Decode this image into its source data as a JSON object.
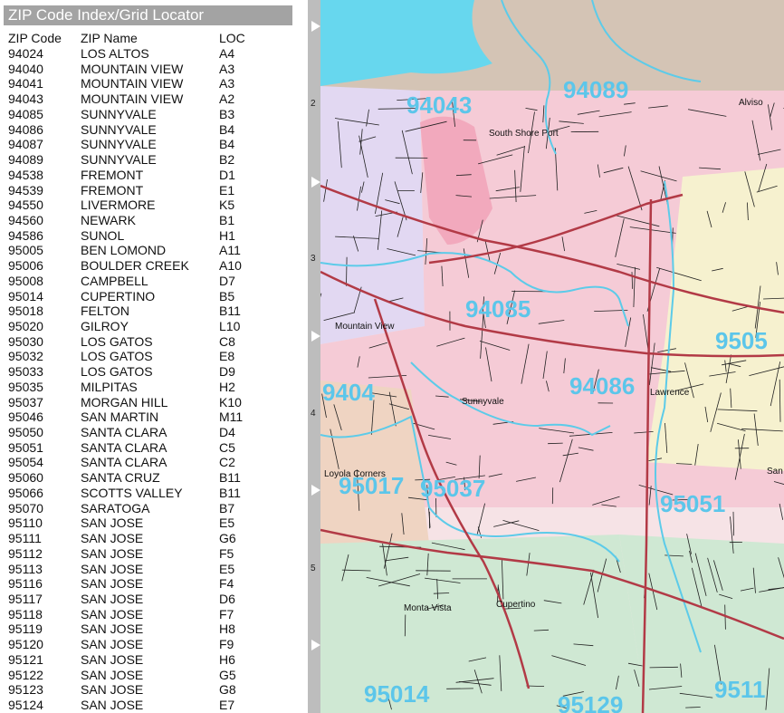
{
  "index": {
    "title": "ZIP Code Index/Grid Locator",
    "columns": [
      "ZIP Code",
      "ZIP Name",
      "LOC"
    ],
    "rows": [
      [
        "94024",
        "LOS ALTOS",
        "A4"
      ],
      [
        "94040",
        "MOUNTAIN VIEW",
        "A3"
      ],
      [
        "94041",
        "MOUNTAIN VIEW",
        "A3"
      ],
      [
        "94043",
        "MOUNTAIN VIEW",
        "A2"
      ],
      [
        "94085",
        "SUNNYVALE",
        "B3"
      ],
      [
        "94086",
        "SUNNYVALE",
        "B4"
      ],
      [
        "94087",
        "SUNNYVALE",
        "B4"
      ],
      [
        "94089",
        "SUNNYVALE",
        "B2"
      ],
      [
        "94538",
        "FREMONT",
        "D1"
      ],
      [
        "94539",
        "FREMONT",
        "E1"
      ],
      [
        "94550",
        "LIVERMORE",
        "K5"
      ],
      [
        "94560",
        "NEWARK",
        "B1"
      ],
      [
        "94586",
        "SUNOL",
        "H1"
      ],
      [
        "95005",
        "BEN LOMOND",
        "A11"
      ],
      [
        "95006",
        "BOULDER CREEK",
        "A10"
      ],
      [
        "95008",
        "CAMPBELL",
        "D7"
      ],
      [
        "95014",
        "CUPERTINO",
        "B5"
      ],
      [
        "95018",
        "FELTON",
        "B11"
      ],
      [
        "95020",
        "GILROY",
        "L10"
      ],
      [
        "95030",
        "LOS GATOS",
        "C8"
      ],
      [
        "95032",
        "LOS GATOS",
        "E8"
      ],
      [
        "95033",
        "LOS GATOS",
        "D9"
      ],
      [
        "95035",
        "MILPITAS",
        "H2"
      ],
      [
        "95037",
        "MORGAN HILL",
        "K10"
      ],
      [
        "95046",
        "SAN MARTIN",
        "M11"
      ],
      [
        "95050",
        "SANTA CLARA",
        "D4"
      ],
      [
        "95051",
        "SANTA CLARA",
        "C5"
      ],
      [
        "95054",
        "SANTA CLARA",
        "C2"
      ],
      [
        "95060",
        "SANTA CRUZ",
        "B11"
      ],
      [
        "95066",
        "SCOTTS VALLEY",
        "B11"
      ],
      [
        "95070",
        "SARATOGA",
        "B7"
      ],
      [
        "95110",
        "SAN JOSE",
        "E5"
      ],
      [
        "95111",
        "SAN JOSE",
        "G6"
      ],
      [
        "95112",
        "SAN JOSE",
        "F5"
      ],
      [
        "95113",
        "SAN JOSE",
        "E5"
      ],
      [
        "95116",
        "SAN JOSE",
        "F4"
      ],
      [
        "95117",
        "SAN JOSE",
        "D6"
      ],
      [
        "95118",
        "SAN JOSE",
        "F7"
      ],
      [
        "95119",
        "SAN JOSE",
        "H8"
      ],
      [
        "95120",
        "SAN JOSE",
        "F9"
      ],
      [
        "95121",
        "SAN JOSE",
        "H6"
      ],
      [
        "95122",
        "SAN JOSE",
        "G5"
      ],
      [
        "95123",
        "SAN JOSE",
        "G8"
      ],
      [
        "95124",
        "SAN JOSE",
        "E7"
      ]
    ]
  },
  "grid_numbers": [
    "2",
    "3",
    "4",
    "5"
  ],
  "map": {
    "zip_labels": [
      "94043",
      "94089",
      "94085",
      "94086",
      "95051",
      "95014",
      "9404",
      "9505",
      "9511",
      "95129",
      "95017",
      "95037"
    ],
    "place_labels": [
      "Mountain View",
      "Sunnyvale",
      "Cupertino",
      "Lawrence",
      "South Shore Port",
      "Loyola Corners",
      "Monta Vista",
      "Alviso",
      "San"
    ],
    "colors": {
      "water": "#67d7ee",
      "zip_label": "#5cc6ea",
      "bay": "#d4c4b5",
      "lavender": "#e2d8f2",
      "pink": "#f5cbd6",
      "airfield": "#f2a9bd",
      "green": "#cfe8d3",
      "yellow": "#f6f1cf",
      "tan": "#efd4c2",
      "highway": "#b23a46",
      "street": "#202020",
      "boundary": "#5ccbe9"
    }
  }
}
